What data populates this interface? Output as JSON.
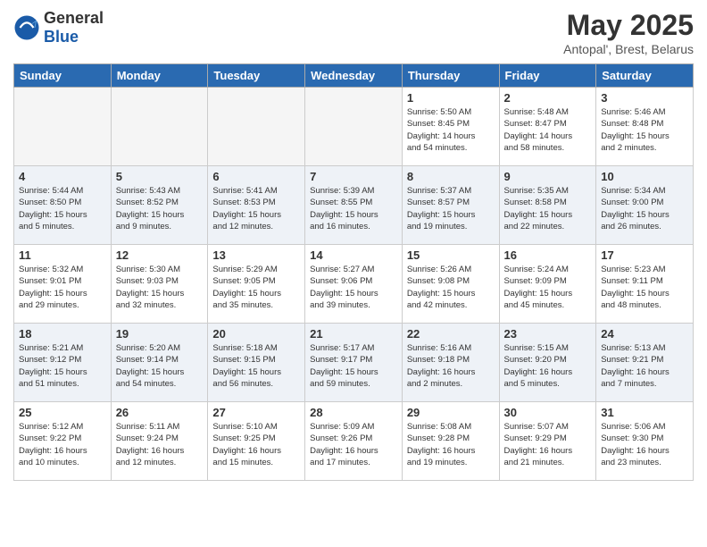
{
  "header": {
    "logo_general": "General",
    "logo_blue": "Blue",
    "month": "May 2025",
    "location": "Antopal', Brest, Belarus"
  },
  "weekdays": [
    "Sunday",
    "Monday",
    "Tuesday",
    "Wednesday",
    "Thursday",
    "Friday",
    "Saturday"
  ],
  "weeks": [
    [
      {
        "day": "",
        "info": ""
      },
      {
        "day": "",
        "info": ""
      },
      {
        "day": "",
        "info": ""
      },
      {
        "day": "",
        "info": ""
      },
      {
        "day": "1",
        "info": "Sunrise: 5:50 AM\nSunset: 8:45 PM\nDaylight: 14 hours\nand 54 minutes."
      },
      {
        "day": "2",
        "info": "Sunrise: 5:48 AM\nSunset: 8:47 PM\nDaylight: 14 hours\nand 58 minutes."
      },
      {
        "day": "3",
        "info": "Sunrise: 5:46 AM\nSunset: 8:48 PM\nDaylight: 15 hours\nand 2 minutes."
      }
    ],
    [
      {
        "day": "4",
        "info": "Sunrise: 5:44 AM\nSunset: 8:50 PM\nDaylight: 15 hours\nand 5 minutes."
      },
      {
        "day": "5",
        "info": "Sunrise: 5:43 AM\nSunset: 8:52 PM\nDaylight: 15 hours\nand 9 minutes."
      },
      {
        "day": "6",
        "info": "Sunrise: 5:41 AM\nSunset: 8:53 PM\nDaylight: 15 hours\nand 12 minutes."
      },
      {
        "day": "7",
        "info": "Sunrise: 5:39 AM\nSunset: 8:55 PM\nDaylight: 15 hours\nand 16 minutes."
      },
      {
        "day": "8",
        "info": "Sunrise: 5:37 AM\nSunset: 8:57 PM\nDaylight: 15 hours\nand 19 minutes."
      },
      {
        "day": "9",
        "info": "Sunrise: 5:35 AM\nSunset: 8:58 PM\nDaylight: 15 hours\nand 22 minutes."
      },
      {
        "day": "10",
        "info": "Sunrise: 5:34 AM\nSunset: 9:00 PM\nDaylight: 15 hours\nand 26 minutes."
      }
    ],
    [
      {
        "day": "11",
        "info": "Sunrise: 5:32 AM\nSunset: 9:01 PM\nDaylight: 15 hours\nand 29 minutes."
      },
      {
        "day": "12",
        "info": "Sunrise: 5:30 AM\nSunset: 9:03 PM\nDaylight: 15 hours\nand 32 minutes."
      },
      {
        "day": "13",
        "info": "Sunrise: 5:29 AM\nSunset: 9:05 PM\nDaylight: 15 hours\nand 35 minutes."
      },
      {
        "day": "14",
        "info": "Sunrise: 5:27 AM\nSunset: 9:06 PM\nDaylight: 15 hours\nand 39 minutes."
      },
      {
        "day": "15",
        "info": "Sunrise: 5:26 AM\nSunset: 9:08 PM\nDaylight: 15 hours\nand 42 minutes."
      },
      {
        "day": "16",
        "info": "Sunrise: 5:24 AM\nSunset: 9:09 PM\nDaylight: 15 hours\nand 45 minutes."
      },
      {
        "day": "17",
        "info": "Sunrise: 5:23 AM\nSunset: 9:11 PM\nDaylight: 15 hours\nand 48 minutes."
      }
    ],
    [
      {
        "day": "18",
        "info": "Sunrise: 5:21 AM\nSunset: 9:12 PM\nDaylight: 15 hours\nand 51 minutes."
      },
      {
        "day": "19",
        "info": "Sunrise: 5:20 AM\nSunset: 9:14 PM\nDaylight: 15 hours\nand 54 minutes."
      },
      {
        "day": "20",
        "info": "Sunrise: 5:18 AM\nSunset: 9:15 PM\nDaylight: 15 hours\nand 56 minutes."
      },
      {
        "day": "21",
        "info": "Sunrise: 5:17 AM\nSunset: 9:17 PM\nDaylight: 15 hours\nand 59 minutes."
      },
      {
        "day": "22",
        "info": "Sunrise: 5:16 AM\nSunset: 9:18 PM\nDaylight: 16 hours\nand 2 minutes."
      },
      {
        "day": "23",
        "info": "Sunrise: 5:15 AM\nSunset: 9:20 PM\nDaylight: 16 hours\nand 5 minutes."
      },
      {
        "day": "24",
        "info": "Sunrise: 5:13 AM\nSunset: 9:21 PM\nDaylight: 16 hours\nand 7 minutes."
      }
    ],
    [
      {
        "day": "25",
        "info": "Sunrise: 5:12 AM\nSunset: 9:22 PM\nDaylight: 16 hours\nand 10 minutes."
      },
      {
        "day": "26",
        "info": "Sunrise: 5:11 AM\nSunset: 9:24 PM\nDaylight: 16 hours\nand 12 minutes."
      },
      {
        "day": "27",
        "info": "Sunrise: 5:10 AM\nSunset: 9:25 PM\nDaylight: 16 hours\nand 15 minutes."
      },
      {
        "day": "28",
        "info": "Sunrise: 5:09 AM\nSunset: 9:26 PM\nDaylight: 16 hours\nand 17 minutes."
      },
      {
        "day": "29",
        "info": "Sunrise: 5:08 AM\nSunset: 9:28 PM\nDaylight: 16 hours\nand 19 minutes."
      },
      {
        "day": "30",
        "info": "Sunrise: 5:07 AM\nSunset: 9:29 PM\nDaylight: 16 hours\nand 21 minutes."
      },
      {
        "day": "31",
        "info": "Sunrise: 5:06 AM\nSunset: 9:30 PM\nDaylight: 16 hours\nand 23 minutes."
      }
    ]
  ]
}
